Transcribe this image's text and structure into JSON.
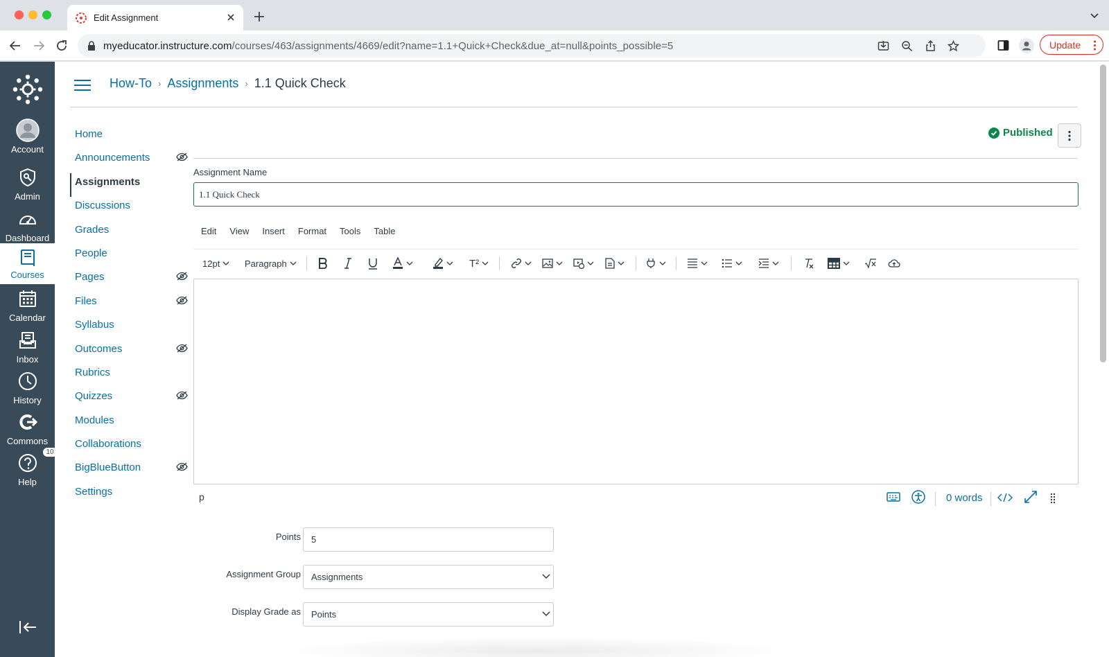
{
  "browser": {
    "tab_title": "Edit Assignment",
    "url_host": "myeducator.instructure.com",
    "url_path": "/courses/463/assignments/4669/edit?name=1.1+Quick+Check&due_at=null&points_possible=5",
    "update_label": "Update"
  },
  "global_nav": {
    "items": [
      {
        "label": "Account",
        "icon": "account-avatar-icon"
      },
      {
        "label": "Admin",
        "icon": "admin-shield-icon"
      },
      {
        "label": "Dashboard",
        "icon": "dashboard-gauge-icon"
      },
      {
        "label": "Courses",
        "icon": "courses-book-icon",
        "active": true
      },
      {
        "label": "Calendar",
        "icon": "calendar-icon"
      },
      {
        "label": "Inbox",
        "icon": "inbox-icon"
      },
      {
        "label": "History",
        "icon": "history-clock-icon"
      },
      {
        "label": "Commons",
        "icon": "commons-icon"
      },
      {
        "label": "Help",
        "icon": "help-icon"
      }
    ],
    "help_badge": "10"
  },
  "breadcrumb": {
    "course": "How-To",
    "section": "Assignments",
    "current": "1.1 Quick Check"
  },
  "course_nav": {
    "items": [
      {
        "label": "Home"
      },
      {
        "label": "Announcements",
        "hidden": true
      },
      {
        "label": "Assignments",
        "active": true
      },
      {
        "label": "Discussions"
      },
      {
        "label": "Grades"
      },
      {
        "label": "People"
      },
      {
        "label": "Pages",
        "hidden": true
      },
      {
        "label": "Files",
        "hidden": true
      },
      {
        "label": "Syllabus"
      },
      {
        "label": "Outcomes",
        "hidden": true
      },
      {
        "label": "Rubrics"
      },
      {
        "label": "Quizzes",
        "hidden": true
      },
      {
        "label": "Modules"
      },
      {
        "label": "Collaborations"
      },
      {
        "label": "BigBlueButton",
        "hidden": true
      },
      {
        "label": "Settings"
      }
    ]
  },
  "header": {
    "status": "Published",
    "status_color": "#0b874b"
  },
  "assignment": {
    "name_label": "Assignment Name",
    "name_value": "1.1 Quick Check"
  },
  "editor": {
    "menus": [
      "Edit",
      "View",
      "Insert",
      "Format",
      "Tools",
      "Table"
    ],
    "font_size": "12pt",
    "block_format": "Paragraph",
    "superscript_label": "T²",
    "path": "p",
    "word_count": "0 words"
  },
  "fields": {
    "points_label": "Points",
    "points_value": "5",
    "group_label": "Assignment Group",
    "group_value": "Assignments",
    "display_label": "Display Grade as",
    "display_value": "Points"
  },
  "colors": {
    "link": "#0770a3",
    "nav_bg": "#394b58",
    "update": "#d93025"
  }
}
